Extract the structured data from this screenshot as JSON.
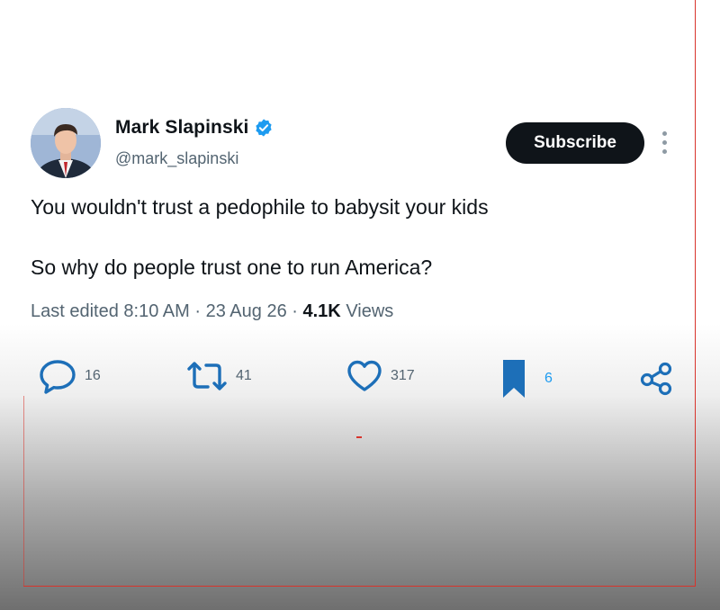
{
  "author": {
    "name": "Mark Slapinski",
    "handle": "@mark_slapinski",
    "verified": true,
    "verified_color": "#1d9bf0"
  },
  "subscribe_label": "Subscribe",
  "tweet": {
    "line1": "You wouldn't trust a pedophile to babysit your kids",
    "line2": "So why do people trust one to run America?"
  },
  "meta": {
    "edited_label": "Last edited",
    "time": "8:10 AM",
    "date": "23 Aug 26",
    "separator": "·",
    "views_count": "4.1K",
    "views_label": "Views"
  },
  "actions": {
    "replies": "16",
    "retweets": "41",
    "likes": "317",
    "bookmarks": "6"
  },
  "icons": {
    "reply": "reply-icon",
    "retweet": "retweet-icon",
    "like": "heart-icon",
    "bookmark": "bookmark-icon",
    "share": "share-icon",
    "more": "more-vertical-icon",
    "verified": "verified-badge-icon"
  },
  "colors": {
    "accent": "#1d9bf0",
    "text": "#0f1419",
    "muted": "#536471",
    "frame": "#d8342c"
  }
}
